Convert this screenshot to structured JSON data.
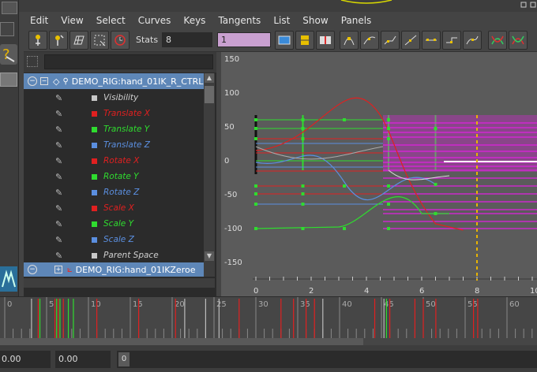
{
  "menu": [
    "Edit",
    "View",
    "Select",
    "Curves",
    "Keys",
    "Tangents",
    "List",
    "Show",
    "Panels"
  ],
  "toolbar": {
    "stats_label": "Stats",
    "stats_value": "8",
    "value_field": "1",
    "icons": [
      "key-move-icon",
      "key-insert-icon",
      "lattice-icon",
      "region-icon",
      "time-icon",
      "frame-all-icon",
      "frame-playback-icon",
      "center-icon",
      "auto-tangent-icon",
      "spline-tangent-icon",
      "clamped-tangent-icon",
      "linear-tangent-icon",
      "flat-tangent-icon",
      "step-tangent-icon",
      "plateau-tangent-icon",
      "buffer-curve-icon",
      "tangent-break-icon"
    ]
  },
  "outliner": {
    "node1": "DEMO_RIG:hand_01IK_R_CTRL",
    "node2": "DEMO_RIG:hand_01IKZeroe",
    "attributes": [
      {
        "label": "Visibility",
        "color": "#c8c8c8"
      },
      {
        "label": "Translate X",
        "color": "#e02020"
      },
      {
        "label": "Translate Y",
        "color": "#2fdc2f"
      },
      {
        "label": "Translate Z",
        "color": "#5b8fe0"
      },
      {
        "label": "Rotate X",
        "color": "#e02020"
      },
      {
        "label": "Rotate Y",
        "color": "#2fdc2f"
      },
      {
        "label": "Rotate Z",
        "color": "#5b8fe0"
      },
      {
        "label": "Scale X",
        "color": "#e02020"
      },
      {
        "label": "Scale Y",
        "color": "#2fdc2f"
      },
      {
        "label": "Scale Z",
        "color": "#5b8fe0"
      },
      {
        "label": "Parent Space",
        "color": "#c8c8c8"
      }
    ]
  },
  "graph": {
    "y_ticks": [
      "150",
      "100",
      "50",
      "0",
      "-50",
      "-100",
      "-150"
    ],
    "x_ticks": [
      "0",
      "2",
      "4",
      "6",
      "8",
      "10"
    ]
  },
  "timeline": {
    "ticks": [
      "0",
      "5",
      "10",
      "15",
      "20",
      "25",
      "30",
      "35",
      "40",
      "45",
      "50",
      "55",
      "60"
    ]
  },
  "range": {
    "start": "0.00",
    "start2": "0.00",
    "current": "0"
  }
}
